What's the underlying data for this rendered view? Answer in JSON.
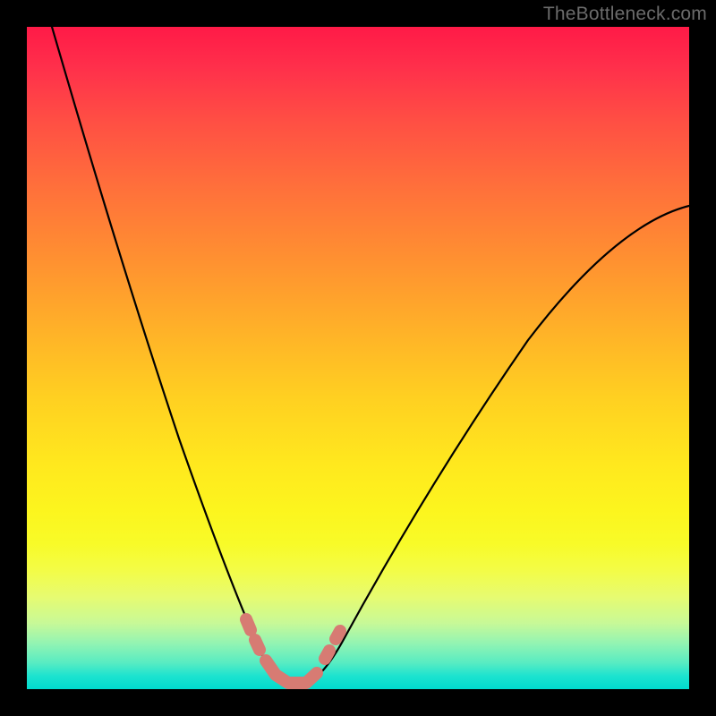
{
  "watermark": "TheBottleneck.com",
  "colors": {
    "frame": "#000000",
    "watermark_text": "#6b6b6b",
    "curve": "#000000",
    "markers": "#d77b73",
    "gradient_stops": [
      "#ff1a47",
      "#ff4e44",
      "#ff9330",
      "#ffd021",
      "#fcf51e",
      "#c8f997",
      "#1de3cf",
      "#00dbce"
    ]
  },
  "chart_data": {
    "type": "line",
    "title": "",
    "xlabel": "",
    "ylabel": "",
    "xlim": [
      0,
      100
    ],
    "ylim": [
      0,
      100
    ],
    "grid": false,
    "legend": false,
    "description": "V-shaped bottleneck curve overlaid on vertical red→green gradient. Minimum (best balance) around x≈37. Salmon-colored marker segment highlights the trough region.",
    "series": [
      {
        "name": "bottleneck_curve",
        "x": [
          3,
          6,
          10,
          14,
          18,
          22,
          26,
          30,
          33,
          35,
          37,
          40,
          43,
          48,
          55,
          63,
          72,
          82,
          92,
          100
        ],
        "y": [
          100,
          89,
          75,
          62,
          50,
          39,
          29,
          19,
          11,
          5,
          1,
          1,
          4,
          10,
          20,
          32,
          45,
          57,
          67,
          73
        ]
      }
    ],
    "highlight_marker": {
      "name": "optimal_region",
      "x_range": [
        30,
        46
      ],
      "y_approx": 3,
      "color": "#d77b73"
    }
  }
}
